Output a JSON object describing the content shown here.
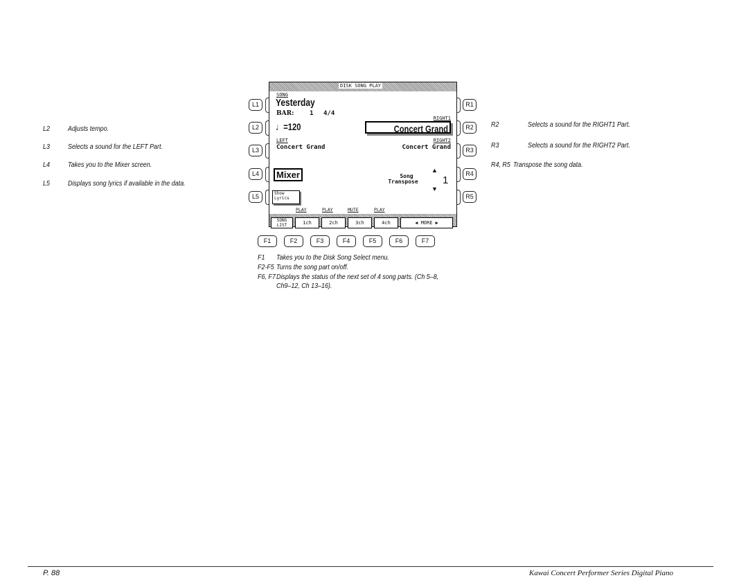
{
  "left_notes": [
    {
      "key": "L2",
      "text": "Adjusts tempo."
    },
    {
      "key": "L3",
      "text": "Selects a sound for the LEFT Part."
    },
    {
      "key": "L4",
      "text": "Takes you to the Mixer screen."
    },
    {
      "key": "L5",
      "text": "Displays song lyrics if available in the data."
    }
  ],
  "right_notes": [
    {
      "key": "R2",
      "text": "Selects a sound for the RIGHT1 Part."
    },
    {
      "key": "R3",
      "text": "Selects a sound for the RIGHT2 Part."
    },
    {
      "key": "R4, R5",
      "text": "Transpose the song data."
    }
  ],
  "left_buttons": [
    "L1",
    "L2",
    "L3",
    "L4",
    "L5"
  ],
  "right_buttons": [
    "R1",
    "R2",
    "R3",
    "R4",
    "R5"
  ],
  "f_buttons": [
    "F1",
    "F2",
    "F3",
    "F4",
    "F5",
    "F6",
    "F7"
  ],
  "screen": {
    "title": "DISK SONG PLAY",
    "song_label": "SONG",
    "song": "Yesterday",
    "bar_label": "BAR:",
    "bar": "1",
    "time_sig": "4/4",
    "tempo": "♩=120",
    "right1_label": "RIGHT1",
    "right1": "Concert Grand",
    "left_label": "LEFT",
    "left": "Concert Grand",
    "right2_label": "RIGHT2",
    "right2": "Concert Grand",
    "mixer": "Mixer",
    "transpose_label1": "Song",
    "transpose_label2": "Transpose",
    "transpose": "1",
    "lyrics1": "Show",
    "lyrics2": "Lyrics",
    "status": [
      "PLAY",
      "PLAY",
      "MUTE",
      "PLAY"
    ],
    "fkeys": [
      "SONG LIST",
      "1ch",
      "2ch",
      "3ch",
      "4ch",
      "◀  MORE  ▶"
    ]
  },
  "captions": [
    {
      "key": "F1",
      "text": "Takes you  to the Disk Song Select menu."
    },
    {
      "key": "F2-F5",
      "text": "Turns the song part on/off."
    },
    {
      "key": "F6, F7",
      "text": "Displays the status of the next set of 4 song parts. (Ch 5–8,"
    },
    {
      "key": "",
      "text": "Ch9–12, Ch 13–16)."
    }
  ],
  "footer": {
    "page": "P. 88",
    "title": "Kawai Concert Performer Series Digital Piano"
  }
}
